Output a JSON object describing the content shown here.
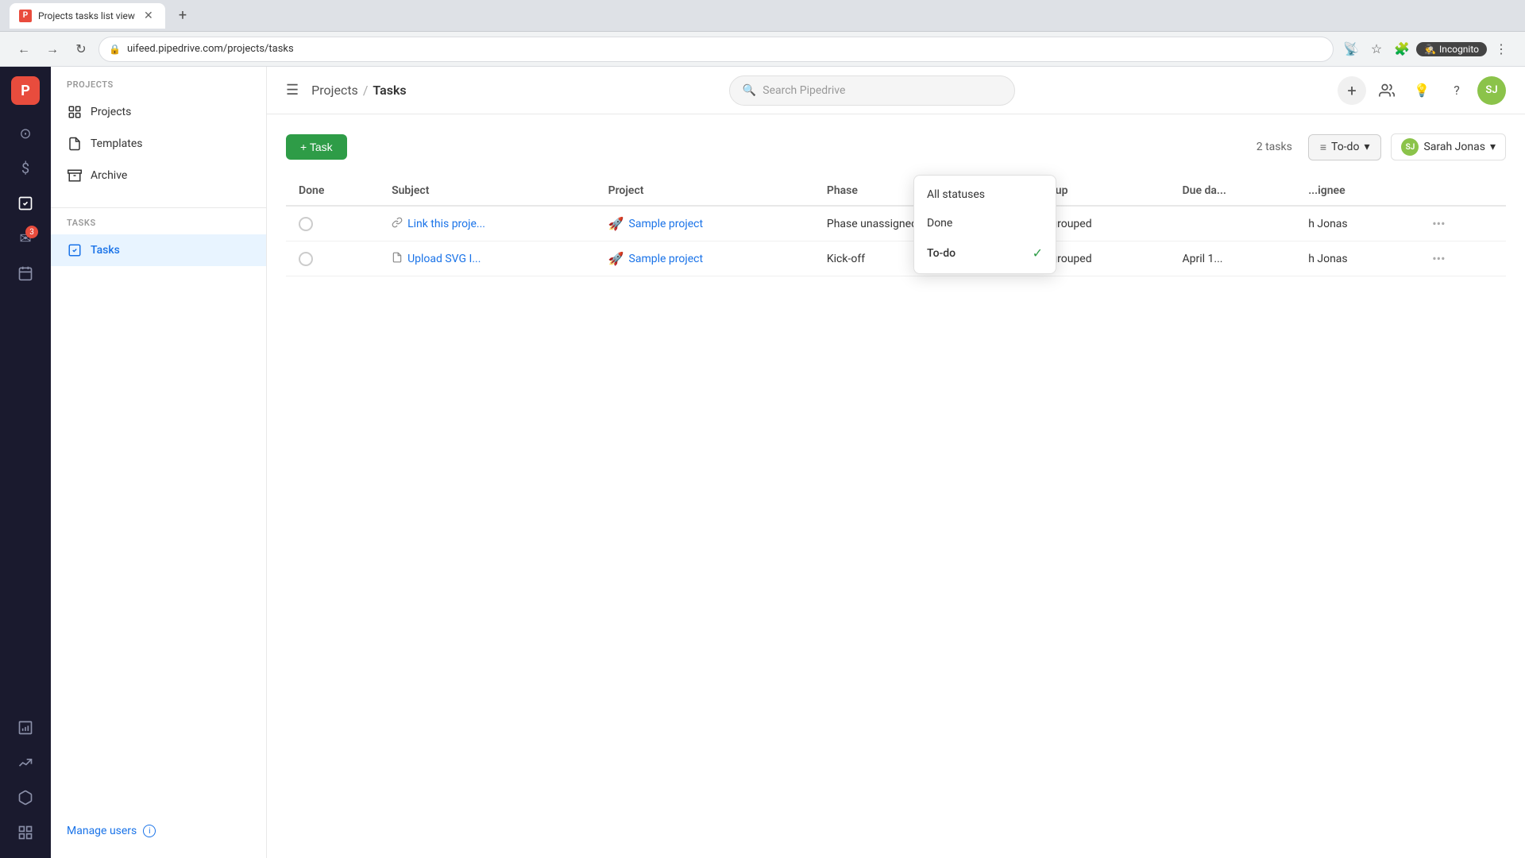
{
  "browser": {
    "tab_title": "Projects tasks list view",
    "tab_favicon": "P",
    "url": "uifeed.pipedrive.com/projects/tasks",
    "incognito_label": "Incognito"
  },
  "header": {
    "menu_icon": "☰",
    "breadcrumb_parent": "Projects",
    "breadcrumb_separator": "/",
    "breadcrumb_current": "Tasks",
    "search_placeholder": "Search Pipedrive",
    "user_initials": "SJ"
  },
  "sidebar": {
    "projects_label": "PROJECTS",
    "tasks_label": "TASKS",
    "nav_items": [
      {
        "id": "projects",
        "label": "Projects"
      },
      {
        "id": "templates",
        "label": "Templates"
      },
      {
        "id": "archive",
        "label": "Archive"
      }
    ],
    "task_items": [
      {
        "id": "tasks",
        "label": "Tasks",
        "active": true
      }
    ],
    "manage_users_label": "Manage users"
  },
  "content": {
    "add_task_label": "+ Task",
    "task_count": "2 tasks",
    "filter_status_label": "To-do",
    "filter_assignee_label": "Sarah Jonas",
    "assignee_initials": "SJ",
    "table": {
      "columns": [
        "Done",
        "Subject",
        "Project",
        "Phase",
        "Group",
        "Due da...",
        "...ignee",
        ""
      ],
      "rows": [
        {
          "done": false,
          "subject": "Link this proje...",
          "subject_icon": "link",
          "project": "Sample project",
          "project_emoji": "🚀",
          "phase": "Phase unassigned",
          "group": "Ungrouped",
          "due_date": "",
          "assignee": "h Jonas",
          "has_attachment": false
        },
        {
          "done": false,
          "subject": "Upload SVG I...",
          "subject_icon": "doc",
          "project": "Sample project",
          "project_emoji": "🚀",
          "phase": "Kick-off",
          "group": "Ungrouped",
          "due_date": "April 1...",
          "assignee": "h Jonas",
          "has_attachment": true
        }
      ]
    }
  },
  "dropdown": {
    "options": [
      {
        "id": "all",
        "label": "All statuses",
        "selected": false
      },
      {
        "id": "done",
        "label": "Done",
        "selected": false
      },
      {
        "id": "todo",
        "label": "To-do",
        "selected": true
      }
    ]
  },
  "left_nav": {
    "logo": "P",
    "icons": [
      {
        "id": "home",
        "symbol": "⊙",
        "active": false
      },
      {
        "id": "deals",
        "symbol": "$",
        "active": false
      },
      {
        "id": "tasks-nav",
        "symbol": "☑",
        "active": true
      },
      {
        "id": "mail",
        "symbol": "✉",
        "active": false,
        "badge": "3"
      },
      {
        "id": "calendar",
        "symbol": "📅",
        "active": false
      },
      {
        "id": "reports",
        "symbol": "📊",
        "active": false
      },
      {
        "id": "insights",
        "symbol": "📈",
        "active": false
      },
      {
        "id": "products",
        "symbol": "📦",
        "active": false
      },
      {
        "id": "marketplace",
        "symbol": "⊞",
        "active": false
      }
    ]
  }
}
